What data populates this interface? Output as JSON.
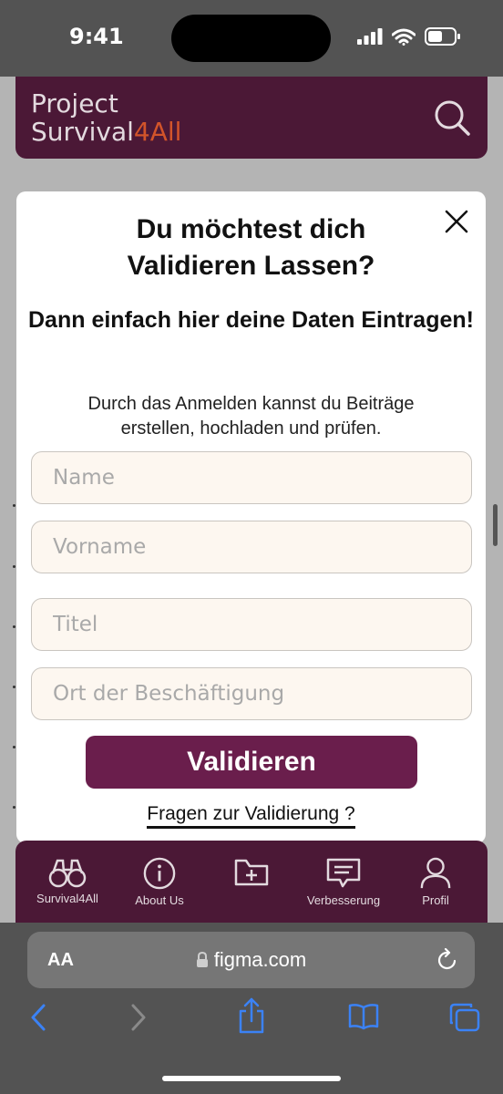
{
  "status_bar": {
    "time": "9:41"
  },
  "header": {
    "logo_line1": "Project",
    "logo_line2_main": "Survival",
    "logo_line2_accent": "4All"
  },
  "modal": {
    "title": "Du möchtest dich\nValidieren Lassen?",
    "subtitle": "Dann einfach hier deine Daten Eintragen!",
    "description": "Durch das Anmelden kannst du Beiträge\nerstellen, hochladen und prüfen.",
    "fields": {
      "name": "Name",
      "vorname": "Vorname",
      "titel": "Titel",
      "ort": "Ort der Beschäftigung"
    },
    "submit_label": "Validieren",
    "faq_link": "Fragen zur Validierung ?"
  },
  "bottom_nav": {
    "items": [
      {
        "label": "Survival4All",
        "icon": "binoculars-icon"
      },
      {
        "label": "About Us",
        "icon": "info-icon"
      },
      {
        "label": "",
        "icon": "folder-add-icon"
      },
      {
        "label": "Verbesserung",
        "icon": "feedback-icon"
      },
      {
        "label": "Profil",
        "icon": "user-icon"
      }
    ]
  },
  "browser": {
    "text_size_label": "AA",
    "url": "figma.com"
  },
  "colors": {
    "brand": "#4b1836",
    "accent": "#d2542a",
    "button": "#6a1e4c",
    "field_bg": "#fdf7f0"
  }
}
